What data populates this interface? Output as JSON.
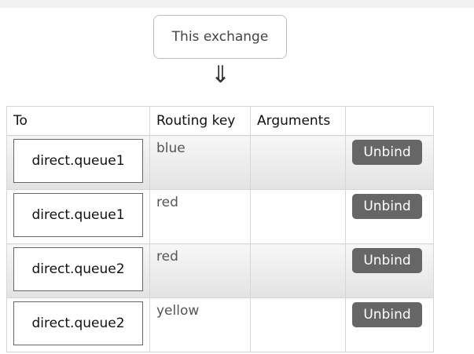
{
  "top": {
    "partial_text": ""
  },
  "exchange": {
    "label": "This exchange"
  },
  "arrow": {
    "glyph": "⇓"
  },
  "table": {
    "headers": {
      "to": "To",
      "routing_key": "Routing key",
      "arguments": "Arguments",
      "actions": ""
    },
    "rows": [
      {
        "to": "direct.queue1",
        "routing_key": "blue",
        "arguments": "",
        "action": "Unbind"
      },
      {
        "to": "direct.queue1",
        "routing_key": "red",
        "arguments": "",
        "action": "Unbind"
      },
      {
        "to": "direct.queue2",
        "routing_key": "red",
        "arguments": "",
        "action": "Unbind"
      },
      {
        "to": "direct.queue2",
        "routing_key": "yellow",
        "arguments": "",
        "action": "Unbind"
      }
    ]
  },
  "colors": {
    "button_bg": "#666666",
    "row_shade_top": "#f7f7f7",
    "row_shade_bottom": "#e3e3e3",
    "border": "#d6d6d6"
  }
}
